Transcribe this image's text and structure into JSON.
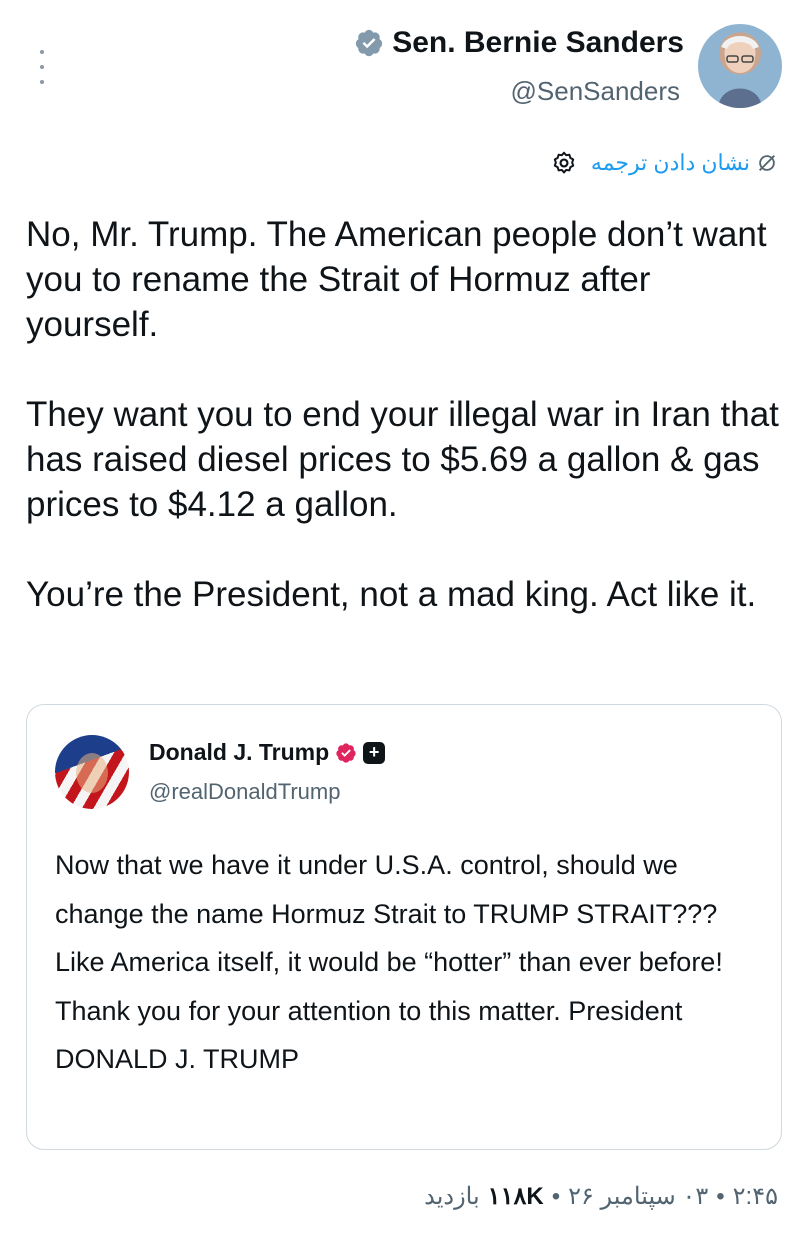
{
  "tweet": {
    "author_name": "Sen. Bernie Sanders",
    "author_handle": "@SenSanders",
    "translate_label": "نشان دادن ترجمه",
    "paragraphs": [
      "No, Mr. Trump. The American people don’t want you to rename the Strait of Hormuz after yourself.",
      "They want you to end your illegal war in Iran that has raised diesel prices to $5.69 a gallon & gas prices to $4.12 a gallon.",
      "You’re the President, not a mad king. Act like it."
    ]
  },
  "quote": {
    "author_name": "Donald J. Trump",
    "author_handle": "@realDonaldTrump",
    "text": "Now that we have it under U.S.A. control, should we change the name Hormuz Strait to TRUMP STRAIT??? Like America itself, it would be “hotter” than ever before! Thank you for your attention to this matter. President DONALD J. TRUMP"
  },
  "footer": {
    "time": "۲:۴۵",
    "separator": "•",
    "date": "۰۳ سپتامبر ۲۶",
    "views_count": "۱۱۸K",
    "views_label": "بازدید"
  },
  "colors": {
    "accent": "#1d9bf0",
    "text": "#0f1419",
    "muted": "#536471",
    "gold_badge": "#e0245e"
  },
  "icons": {
    "more": "more-vertical-icon",
    "verified": "verified-grey-badge-icon",
    "translate": "no-translate-icon",
    "settings": "gear-icon",
    "affiliate": "affiliate-badge-icon"
  }
}
